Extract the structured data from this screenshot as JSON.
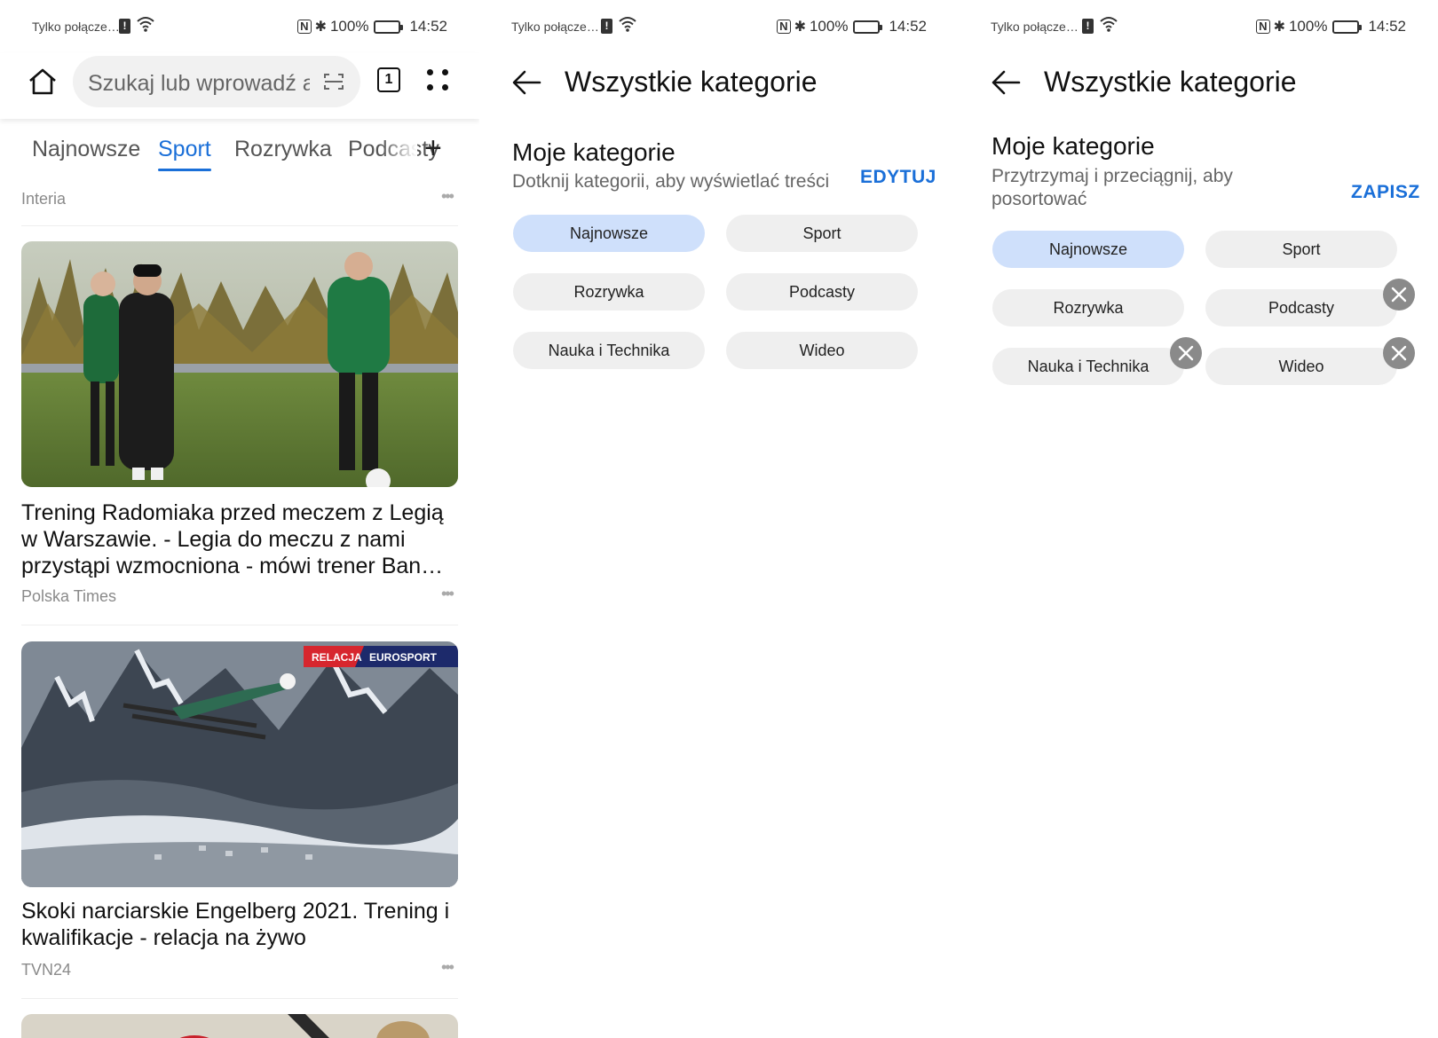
{
  "status": {
    "carrier": "Tylko połącze…",
    "alert": "!",
    "wifi_label": "6",
    "battery": "100%",
    "time": "14:52"
  },
  "browser": {
    "search_placeholder": "Szukaj lub wprowadź a",
    "tab_count": "1",
    "category_tabs": [
      "Najnowsze",
      "Sport",
      "Rozrywka",
      "Podcasty"
    ],
    "add_tab": "+",
    "first_source": "Interia",
    "articles": [
      {
        "headline": "Trening Radomiaka przed meczem z Legią w Warszawie. - Legia do meczu z nami przystąpi wzmocniona - mówi trener Ban…",
        "source": "Polska Times"
      },
      {
        "headline": "Skoki narciarskie Engelberg 2021. Trening i kwalifikacje - relacja na żywo",
        "source": "TVN24",
        "badge_left": "RELACJA",
        "badge_right": "EUROSPORT"
      }
    ],
    "more_dots": "•••"
  },
  "categories_view": {
    "title": "Wszystkie kategorie",
    "section": "Moje kategorie",
    "hint": "Dotknij kategorii, aby wyświetlać treści",
    "action": "EDYTUJ",
    "chips": [
      "Najnowsze",
      "Sport",
      "Rozrywka",
      "Podcasty",
      "Nauka i Technika",
      "Wideo"
    ]
  },
  "categories_edit": {
    "title": "Wszystkie kategorie",
    "section": "Moje kategorie",
    "hint_line1": "Przytrzymaj i przeciągnij, aby",
    "hint_line2": "posortować",
    "action": "ZAPISZ",
    "chips": [
      "Najnowsze",
      "Sport",
      "Rozrywka",
      "Podcasty",
      "Nauka i Technika",
      "Wideo"
    ]
  },
  "colors": {
    "accent": "#1a6fd8",
    "chip_selected": "#cfe0fb",
    "chip": "#efefef"
  }
}
